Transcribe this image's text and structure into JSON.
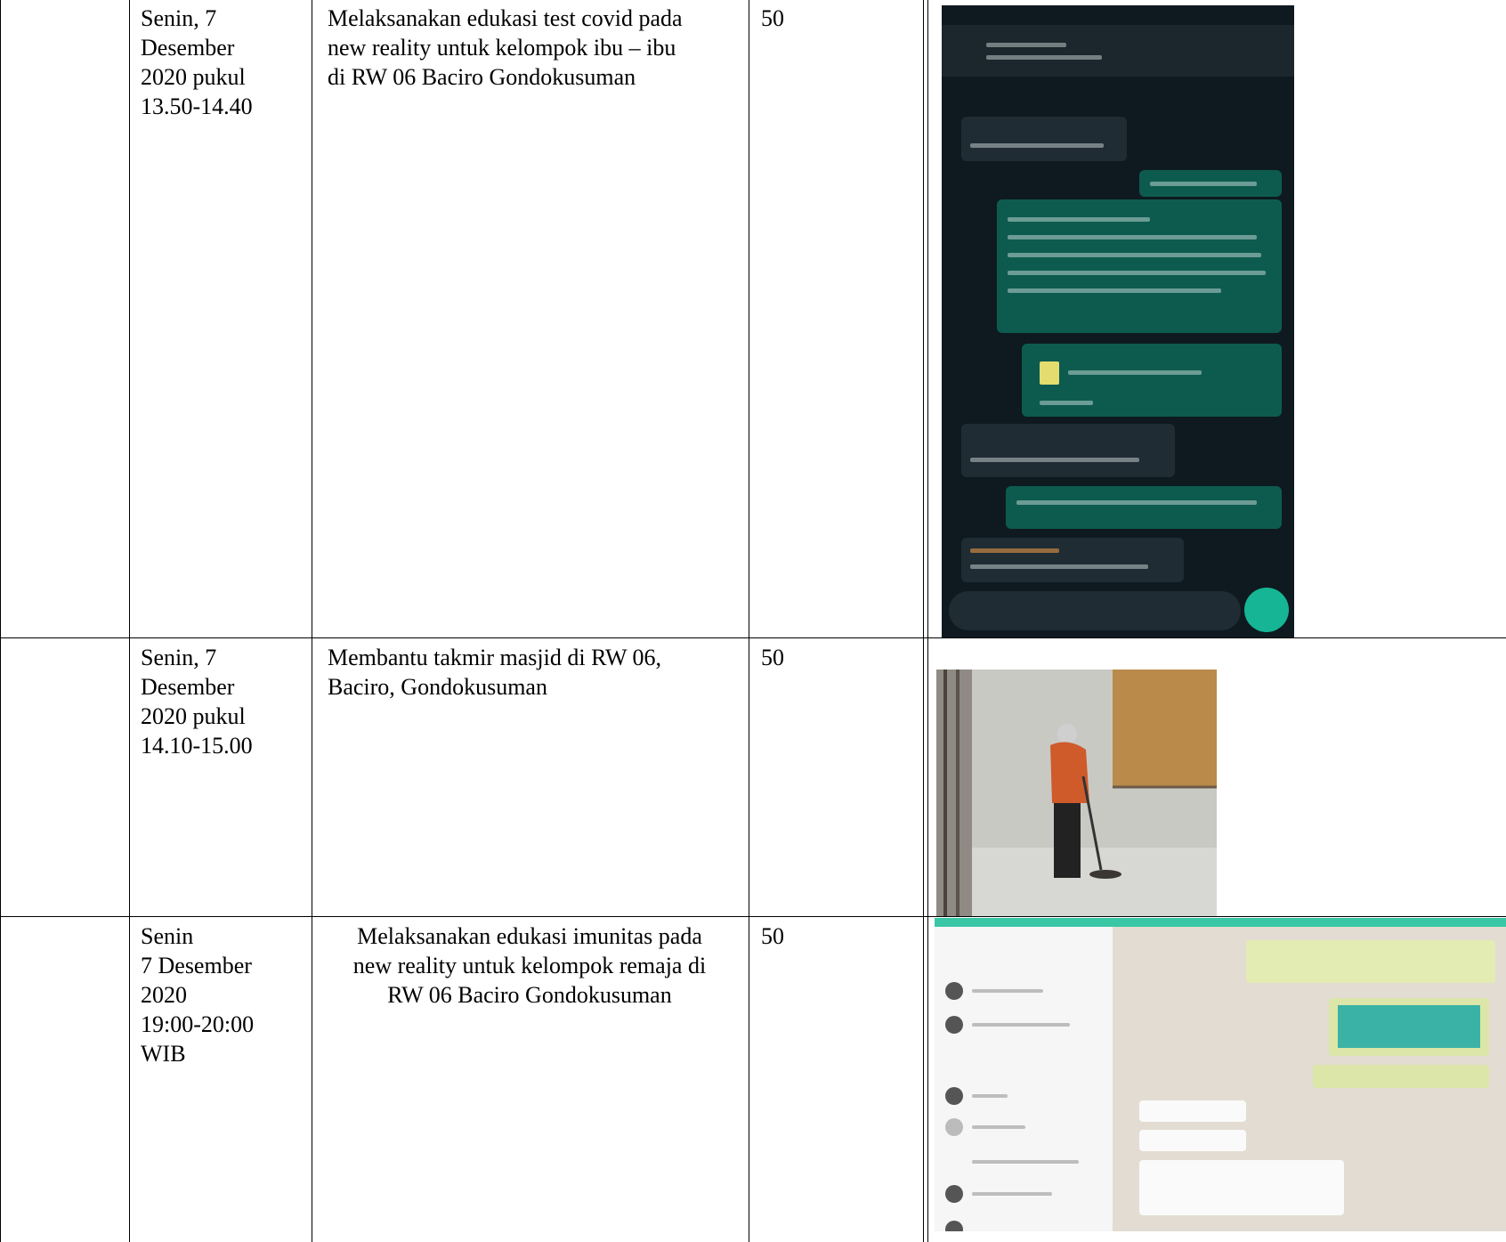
{
  "rows": [
    {
      "date_lines": [
        "Senin, 7",
        "Desember",
        "2020 pukul",
        "13.50-14.40"
      ],
      "activity_lines": [
        "Melaksanakan edukasi test covid pada",
        "new reality untuk kelompok ibu – ibu",
        "di RW 06 Baciro Gondokusuman"
      ],
      "activity_align": "left",
      "value": "50",
      "evidence": "whatsapp-mobile-chat-screenshot"
    },
    {
      "date_lines": [
        "Senin, 7",
        "Desember",
        "2020 pukul",
        "14.10-15.00"
      ],
      "activity_lines": [
        "Membantu takmir masjid di RW 06,",
        "Baciro, Gondokusuman"
      ],
      "activity_align": "left",
      "value": "50",
      "evidence": "mosque-sweeping-photo"
    },
    {
      "date_lines": [
        "Senin",
        "7 Desember",
        "2020",
        "19:00-20:00",
        "WIB"
      ],
      "activity_lines": [
        "Melaksanakan edukasi imunitas pada",
        "new reality untuk kelompok remaja di",
        "RW 06 Baciro Gondokusuman"
      ],
      "activity_align": "center",
      "value": "50",
      "evidence": "whatsapp-desktop-chat-screenshot"
    }
  ],
  "colors": {
    "chat_dark_bg": "#0e1a20",
    "chat_outgoing": "#0d5b4f",
    "accent_teal": "#16b595",
    "desktop_header": "#39c7a6"
  }
}
